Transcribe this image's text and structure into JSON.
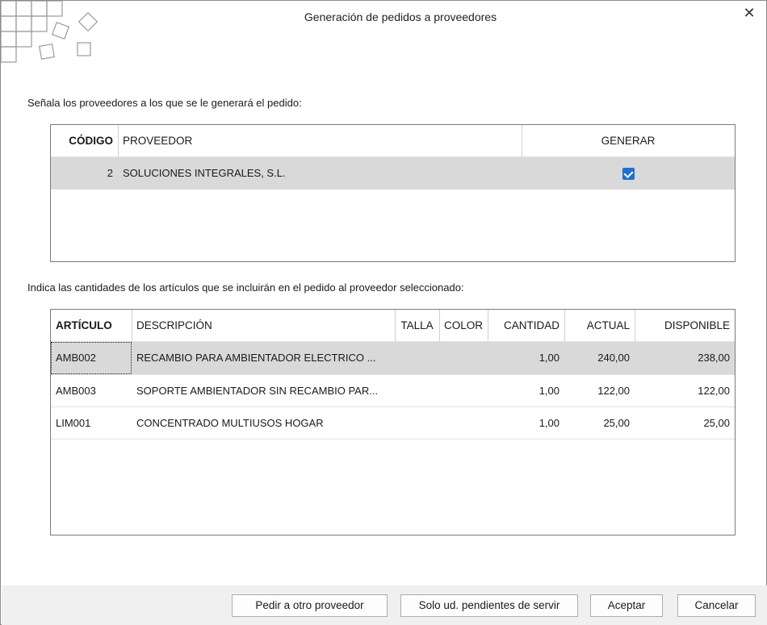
{
  "window": {
    "title": "Generación de pedidos a proveedores",
    "close_glyph": "✕"
  },
  "suppliers_section": {
    "label": "Señala los proveedores a los que se le generará el pedido:",
    "headers": {
      "code": "CÓDIGO",
      "supplier": "PROVEEDOR",
      "generate": "GENERAR"
    },
    "rows": [
      {
        "code": "2",
        "supplier": "SOLUCIONES INTEGRALES, S.L.",
        "generate": true
      }
    ]
  },
  "articles_section": {
    "label": "Indica las cantidades de los artículos que se incluirán en el pedido al proveedor seleccionado:",
    "headers": {
      "article": "ARTÍCULO",
      "description": "DESCRIPCIÓN",
      "size": "TALLA",
      "color": "COLOR",
      "quantity": "CANTIDAD",
      "current": "ACTUAL",
      "available": "DISPONIBLE"
    },
    "rows": [
      {
        "article": "AMB002",
        "description": "RECAMBIO PARA AMBIENTADOR ELECTRICO ...",
        "size": "",
        "color": "",
        "quantity": "1,00",
        "current": "240,00",
        "available": "238,00"
      },
      {
        "article": "AMB003",
        "description": "SOPORTE AMBIENTADOR SIN RECAMBIO PAR...",
        "size": "",
        "color": "",
        "quantity": "1,00",
        "current": "122,00",
        "available": "122,00"
      },
      {
        "article": "LIM001",
        "description": "CONCENTRADO MULTIUSOS HOGAR",
        "size": "",
        "color": "",
        "quantity": "1,00",
        "current": "25,00",
        "available": "25,00"
      }
    ]
  },
  "buttons": {
    "other_supplier": "Pedir a otro proveedor",
    "pending_only": "Solo ud. pendientes de servir",
    "accept": "Aceptar",
    "cancel": "Cancelar"
  },
  "colors": {
    "accent": "#1f6fce",
    "selected_row": "#d9d9d9",
    "footer": "#f0f0f0"
  }
}
